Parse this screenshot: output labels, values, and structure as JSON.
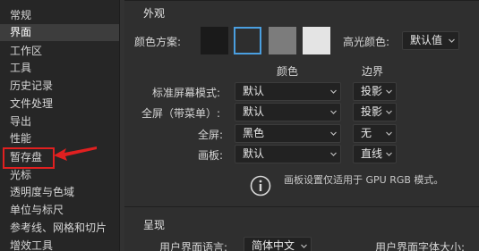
{
  "sidebar": {
    "items": [
      {
        "label": "常规",
        "selected": false
      },
      {
        "label": "界面",
        "selected": true
      },
      {
        "label": "工作区",
        "selected": false
      },
      {
        "label": "工具",
        "selected": false
      },
      {
        "label": "历史记录",
        "selected": false
      },
      {
        "label": "文件处理",
        "selected": false
      },
      {
        "label": "导出",
        "selected": false
      },
      {
        "label": "性能",
        "selected": false
      },
      {
        "label": "暂存盘",
        "selected": false
      },
      {
        "label": "光标",
        "selected": false
      },
      {
        "label": "透明度与色域",
        "selected": false
      },
      {
        "label": "单位与标尺",
        "selected": false
      },
      {
        "label": "参考线、网格和切片",
        "selected": false
      },
      {
        "label": "增效工具",
        "selected": false
      }
    ]
  },
  "appearance": {
    "title": "外观",
    "color_scheme_label": "颜色方案:",
    "swatches": [
      {
        "color": "#1a1a1a",
        "selected": false
      },
      {
        "color": "#2e2e2e",
        "selected": true
      },
      {
        "color": "#7c7c7c",
        "selected": false
      },
      {
        "color": "#e4e4e4",
        "selected": false
      }
    ],
    "highlight_label": "高光颜色:",
    "highlight_value": "默认值",
    "col_color": "颜色",
    "col_border": "边界",
    "rows": [
      {
        "label": "标准屏幕模式:",
        "color": "默认",
        "border": "投影"
      },
      {
        "label": "全屏（带菜单）:",
        "color": "默认",
        "border": "投影"
      },
      {
        "label": "全屏:",
        "color": "黑色",
        "border": "无"
      },
      {
        "label": "画板:",
        "color": "默认",
        "border": "直线"
      }
    ],
    "info_icon": "info-circle-icon",
    "info_text": "画板设置仅适用于 GPU RGB 模式。"
  },
  "presentation": {
    "title": "呈现",
    "ui_language_label": "用户界面语言:",
    "ui_language_value": "简体中文",
    "ui_font_size_label": "用户界面字体大小:"
  },
  "highlight_color": "#e02020"
}
